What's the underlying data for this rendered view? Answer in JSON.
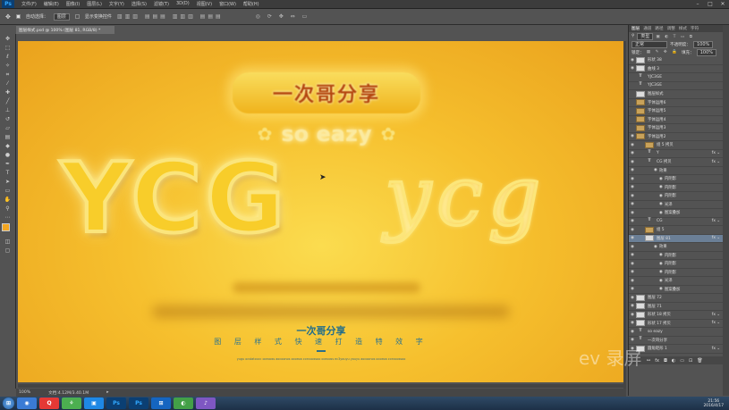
{
  "app": {
    "logo": "Ps"
  },
  "menu": [
    "文件(F)",
    "编辑(E)",
    "图像(I)",
    "图层(L)",
    "文字(Y)",
    "选择(S)",
    "滤镜(T)",
    "3D(D)",
    "视图(V)",
    "窗口(W)",
    "帮助(H)"
  ],
  "options": {
    "auto_select_label": "自动选择：",
    "auto_select_value": "图层",
    "transform_label": "显示变换控件"
  },
  "document": {
    "tab_label": "图层样式.psd @ 100% (图层 81, RGB/8) *",
    "zoom": "100%",
    "doc_info": "文档:4.12M/3.40.1M"
  },
  "canvas": {
    "banner_text": "一次哥分享",
    "tagline": "so eazy",
    "big_word": "YCG",
    "script_word": "ycg",
    "subtitle": "一次哥分享",
    "subtitle2": "图 层 样 式 快 速 打 造 特 效 字",
    "fine_print": "yugu ocstatcocc oceooss aocoonos ocoeoa ccecoossoo oceooss ec3youyu youyu aocoonos ocoeoa ccecoossoo",
    "bg_color": "#f6c02e"
  },
  "panel": {
    "tabs": [
      "图层",
      "通道",
      "路径",
      "调整",
      "样式",
      "字符"
    ],
    "kind_label": "类型",
    "blend_mode": "正常",
    "opacity_label": "不透明度：",
    "opacity": "100%",
    "lock_label": "锁定：",
    "fill_label": "填充：",
    "fill": "100%",
    "layers": [
      {
        "name": "形状 38",
        "type": "shape",
        "visible": true
      },
      {
        "name": "曲线 3",
        "type": "adjust",
        "visible": true
      },
      {
        "name": "YJC3GE",
        "type": "text",
        "visible": false
      },
      {
        "name": "YJC3GE",
        "type": "text",
        "visible": false
      },
      {
        "name": "图层样式",
        "type": "shape",
        "visible": false
      },
      {
        "name": "字体运用6",
        "type": "folder",
        "visible": false
      },
      {
        "name": "字体运用5",
        "type": "folder",
        "visible": false
      },
      {
        "name": "字体运用4",
        "type": "folder",
        "visible": false
      },
      {
        "name": "字体运用3",
        "type": "folder",
        "visible": false
      },
      {
        "name": "字体运用2",
        "type": "folder",
        "visible": true
      },
      {
        "name": "组 5 拷贝",
        "type": "folder",
        "visible": true
      },
      {
        "name": "Y",
        "type": "text",
        "visible": true,
        "fx": true
      },
      {
        "name": "CG 拷贝",
        "type": "text",
        "visible": true,
        "fx": true
      },
      {
        "name": "效果",
        "type": "effect",
        "visible": true
      },
      {
        "name": "内阴影",
        "type": "effect",
        "visible": true
      },
      {
        "name": "内阴影",
        "type": "effect",
        "visible": true
      },
      {
        "name": "内阴影",
        "type": "effect",
        "visible": true
      },
      {
        "name": "光泽",
        "type": "effect",
        "visible": true
      },
      {
        "name": "图案叠加",
        "type": "effect",
        "visible": true
      },
      {
        "name": "CG",
        "type": "text",
        "visible": true,
        "fx": true
      },
      {
        "name": "组 5",
        "type": "folder",
        "visible": true
      },
      {
        "name": "图层 81",
        "type": "shape",
        "visible": true,
        "fx": true,
        "selected": true
      },
      {
        "name": "效果",
        "type": "effect",
        "visible": true
      },
      {
        "name": "内阴影",
        "type": "effect",
        "visible": true
      },
      {
        "name": "内阴影",
        "type": "effect",
        "visible": true
      },
      {
        "name": "内阴影",
        "type": "effect",
        "visible": true
      },
      {
        "name": "光泽",
        "type": "effect",
        "visible": true
      },
      {
        "name": "图案叠加",
        "type": "effect",
        "visible": true
      },
      {
        "name": "图层 72",
        "type": "shape",
        "visible": true
      },
      {
        "name": "图层 71",
        "type": "shape",
        "visible": true
      },
      {
        "name": "形状 18 拷贝",
        "type": "shape",
        "visible": true,
        "fx": true
      },
      {
        "name": "形状 17 拷贝",
        "type": "shape",
        "visible": true,
        "fx": true
      },
      {
        "name": "so eazy",
        "type": "text",
        "visible": true
      },
      {
        "name": "一次哥分享",
        "type": "text",
        "visible": true
      },
      {
        "name": "圆角矩形 1",
        "type": "shape",
        "visible": true,
        "fx": true
      }
    ]
  },
  "taskbar": {
    "apps": [
      "◉",
      "Q",
      "⚘",
      "▣",
      "Ps",
      "Ps",
      "⊞",
      "◐",
      "♪"
    ],
    "time": "21:56",
    "date": "2016/4/17"
  },
  "watermark": "ev 录屏"
}
